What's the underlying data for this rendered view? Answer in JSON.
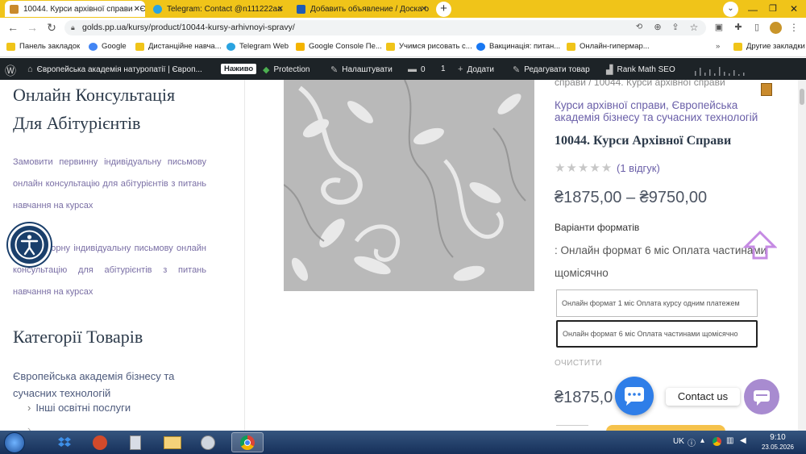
{
  "browser": {
    "tabs": [
      {
        "title": "10044. Курси архівної справи - Є",
        "active": true,
        "favicon_color": "#c98a2c"
      },
      {
        "title": "Telegram: Contact @n111222aa",
        "active": false,
        "favicon_color": "#2aa3e0"
      },
      {
        "title": "Добавить объявление / Доска о",
        "active": false,
        "favicon_color": "#1f5bb5"
      }
    ],
    "url": "golds.pp.ua/kursy/product/10044-kursy-arhivnoyi-spravy/",
    "bookmarks": [
      {
        "label": "Панель закладок",
        "icon_color": "#f0c419"
      },
      {
        "label": "Google",
        "icon_color": "#4285f4"
      },
      {
        "label": "Дистанційне навча...",
        "icon_color": "#f0c419"
      },
      {
        "label": "Telegram Web",
        "icon_color": "#2aa3e0"
      },
      {
        "label": "Google Console Пе...",
        "icon_color": "#f4b400"
      },
      {
        "label": "Учимся рисовать с...",
        "icon_color": "#f0c419"
      },
      {
        "label": "Вакцинація: питан...",
        "icon_color": "#1877f2"
      },
      {
        "label": "Онлайн-гипермар...",
        "icon_color": "#f0c419"
      }
    ],
    "other_bookmarks": "Другие закладки"
  },
  "wpbar": {
    "site_name": "Європейська академія натуропатії | Європ...",
    "live_badge": "Наживо",
    "protection": "Protection",
    "customize": "Налаштувати",
    "comments_count": "0",
    "updates_count": "1",
    "add_new": "Додати",
    "edit_product": "Редагувати товар",
    "rank_math": "Rank Math SEO"
  },
  "sidebar": {
    "consult_heading_line1": "Онлайн Консультація",
    "consult_heading_line2": "Для Абітурієнтів",
    "consult_text_1": "Замовити первинну індивідуальну письмову онлайн консультацію для абітурієнтів з питань навчання на курсах",
    "consult_text_2": "...ти повторну індивідуальну письмову онлайн консультацію для абітурієнтів з питань навчання на курсах",
    "categories_heading": "Категорії Товарів",
    "category_main": "Європейська академія бізнесу та сучасних технологій",
    "category_sub": "Інші освітні послуги"
  },
  "product": {
    "breadcrumb": "справи / 10044. Курси архівної справи",
    "category_link": "Курси архівної справи, Європейська академія бізнесу та сучасних технологій",
    "title": "10044. Курси Архівної Справи",
    "rating": 5,
    "reviews": "(1 відгук)",
    "price_range": "₴1875,00 – ₴9750,00",
    "variants_label": "Варіанти форматів",
    "selected_variant": ": Онлайн формат 6 міс Оплата частинами щомісячно",
    "variant_options": [
      "Онлайн формат 1 міс Оплата курсу одним платежем",
      "Онлайн формат 6 міс Оплата частинами щомісячно"
    ],
    "clear_label": "ОЧИСТИТИ",
    "current_price": "₴1875,0"
  },
  "contact": {
    "label": "Contact us"
  },
  "taskbar": {
    "lang": "UK",
    "time": "9:10",
    "date": "23.05.2026"
  }
}
